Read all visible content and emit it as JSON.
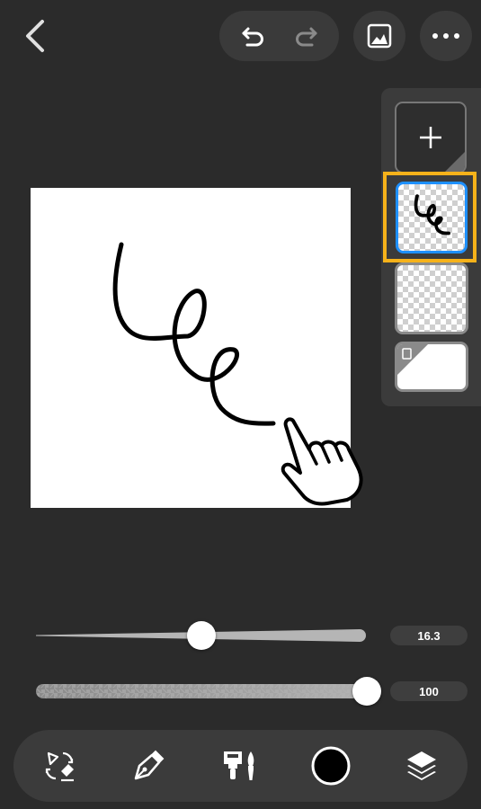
{
  "header": {
    "back_icon": "chevron-left-icon",
    "undo_icon": "undo-icon",
    "redo_icon": "redo-icon",
    "image_icon": "image-icon",
    "more_icon": "more-horizontal-icon"
  },
  "layers": {
    "add_icon": "plus-icon",
    "items": [
      {
        "name": "stroke-layer",
        "selected": true
      },
      {
        "name": "empty-layer",
        "selected": false
      },
      {
        "name": "paper-layer",
        "selected": false
      }
    ],
    "highlight_color": "#f6b21a",
    "selected_border_color": "#1e90ff"
  },
  "sliders": {
    "size_value": "16.3",
    "size_position": 0.5,
    "opacity_value": "100",
    "opacity_position": 1.0
  },
  "toolbar": {
    "tools": [
      "transform-eraser-icon",
      "pen-icon",
      "brush-icon",
      "color-swatch",
      "layers-icon"
    ],
    "current_color": "#000000"
  },
  "colors": {
    "background": "#2b2b2b",
    "panel": "#3b3b3b"
  }
}
